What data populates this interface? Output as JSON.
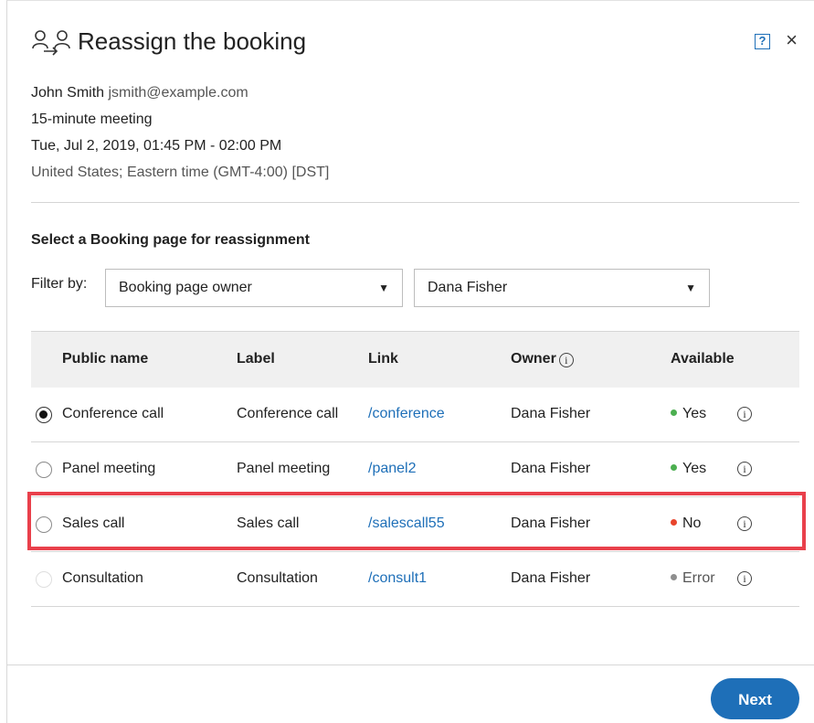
{
  "dialog": {
    "title": "Reassign the booking",
    "help_label": "?",
    "close_label": "×"
  },
  "booking": {
    "name": "John Smith",
    "email": "jsmith@example.com",
    "meeting_type": "15-minute meeting",
    "datetime": "Tue, Jul 2, 2019, 01:45 PM - 02:00 PM",
    "timezone": "United States; Eastern time (GMT-4:00) [DST]"
  },
  "section_title": "Select a Booking page for reassignment",
  "filter": {
    "label": "Filter by:",
    "field_value": "Booking page owner",
    "owner_value": "Dana Fisher"
  },
  "table": {
    "columns": [
      "Public name",
      "Label",
      "Link",
      "Owner",
      "Available"
    ],
    "rows": [
      {
        "public_name": "Conference call",
        "label": "Conference call",
        "link": "/conference",
        "owner": "Dana Fisher",
        "available": "Yes",
        "status_color": "#4caf50",
        "selected": true
      },
      {
        "public_name": "Panel meeting",
        "label": "Panel meeting",
        "link": "/panel2",
        "owner": "Dana Fisher",
        "available": "Yes",
        "status_color": "#4caf50",
        "selected": false
      },
      {
        "public_name": "Sales call",
        "label": "Sales call",
        "link": "/salescall55",
        "owner": "Dana Fisher",
        "available": "No",
        "status_color": "#e8442c",
        "selected": false
      },
      {
        "public_name": "Consultation",
        "label": "Consultation",
        "link": "/consult1",
        "owner": "Dana Fisher",
        "available": "Error",
        "status_color": "#8f8f8f",
        "selected": false
      }
    ]
  },
  "footer": {
    "next_label": "Next"
  },
  "colors": {
    "accent": "#1e6fb8",
    "highlight": "#e9404b"
  }
}
